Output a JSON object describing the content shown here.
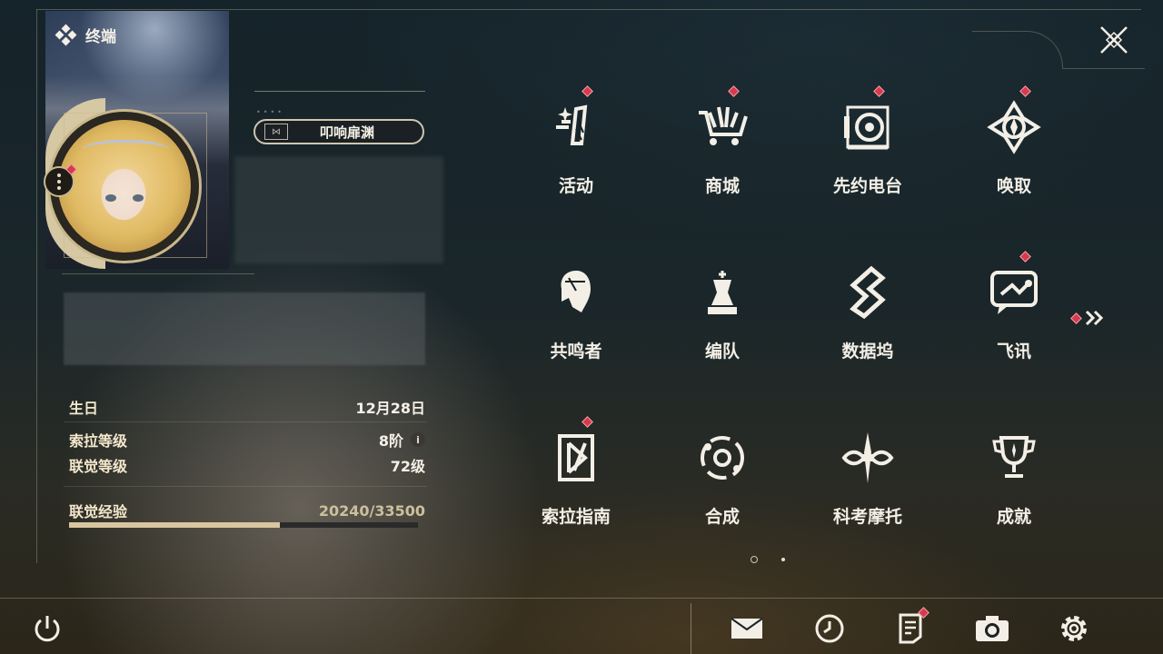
{
  "card": {
    "title": "终端"
  },
  "profile": {
    "tag_label": "叩响扉渊",
    "dots": "••••"
  },
  "stats": {
    "birthday": {
      "label": "生日",
      "value": "12月28日"
    },
    "sola_level": {
      "label": "索拉等级",
      "value": "8阶",
      "info": "i"
    },
    "union_level": {
      "label": "联觉等级",
      "value": "72级"
    },
    "union_exp": {
      "label": "联觉经验",
      "value": "20240/33500",
      "current": 20240,
      "max": 33500
    }
  },
  "menu": [
    {
      "label": "活动",
      "icon": "events-icon",
      "badge": true
    },
    {
      "label": "商城",
      "icon": "shop-cart-icon",
      "badge": true
    },
    {
      "label": "先约电台",
      "icon": "radio-icon",
      "badge": true
    },
    {
      "label": "唤取",
      "icon": "convene-icon",
      "badge": true
    },
    {
      "label": "共鸣者",
      "icon": "resonator-icon",
      "badge": false
    },
    {
      "label": "编队",
      "icon": "team-icon",
      "badge": false
    },
    {
      "label": "数据坞",
      "icon": "data-dock-icon",
      "badge": false
    },
    {
      "label": "飞讯",
      "icon": "chat-icon",
      "badge": true
    },
    {
      "label": "索拉指南",
      "icon": "guidebook-icon",
      "badge": true
    },
    {
      "label": "合成",
      "icon": "synthesis-icon",
      "badge": false
    },
    {
      "label": "科考摩托",
      "icon": "motorcycle-icon",
      "badge": false
    },
    {
      "label": "成就",
      "icon": "trophy-icon",
      "badge": false
    }
  ],
  "colors": {
    "badge": "#d63a4d",
    "accent": "#c9b88c",
    "exp_fill": "#d9c6a0"
  }
}
